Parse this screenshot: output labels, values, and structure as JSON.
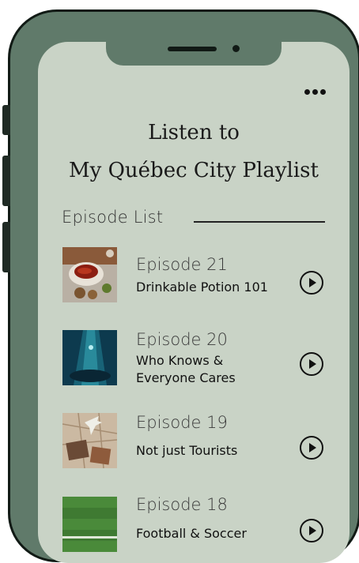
{
  "header": {
    "title_line1": "Listen to",
    "title_line2": "My Québec City Playlist",
    "more_icon": "more-horizontal-icon"
  },
  "section": {
    "label": "Episode List"
  },
  "episodes": [
    {
      "number": "Episode 21",
      "title_lines": [
        "Drinkable Potion 101"
      ],
      "thumb_icon": "tea-cup-thumbnail",
      "play_icon": "play-circle-icon"
    },
    {
      "number": "Episode 20",
      "title_lines": [
        "Who Knows &",
        "Everyone Cares"
      ],
      "thumb_icon": "underwater-light-thumbnail",
      "play_icon": "play-circle-icon"
    },
    {
      "number": "Episode 19",
      "title_lines": [
        "Not just Tourists"
      ],
      "thumb_icon": "map-photos-thumbnail",
      "play_icon": "play-circle-icon"
    },
    {
      "number": "Episode 18",
      "title_lines": [
        "Football & Soccer"
      ],
      "thumb_icon": "grass-field-thumbnail",
      "play_icon": "play-circle-icon"
    }
  ],
  "colors": {
    "phone_frame": "#607a6a",
    "screen_bg": "#c9d3c6",
    "text": "#111111"
  }
}
